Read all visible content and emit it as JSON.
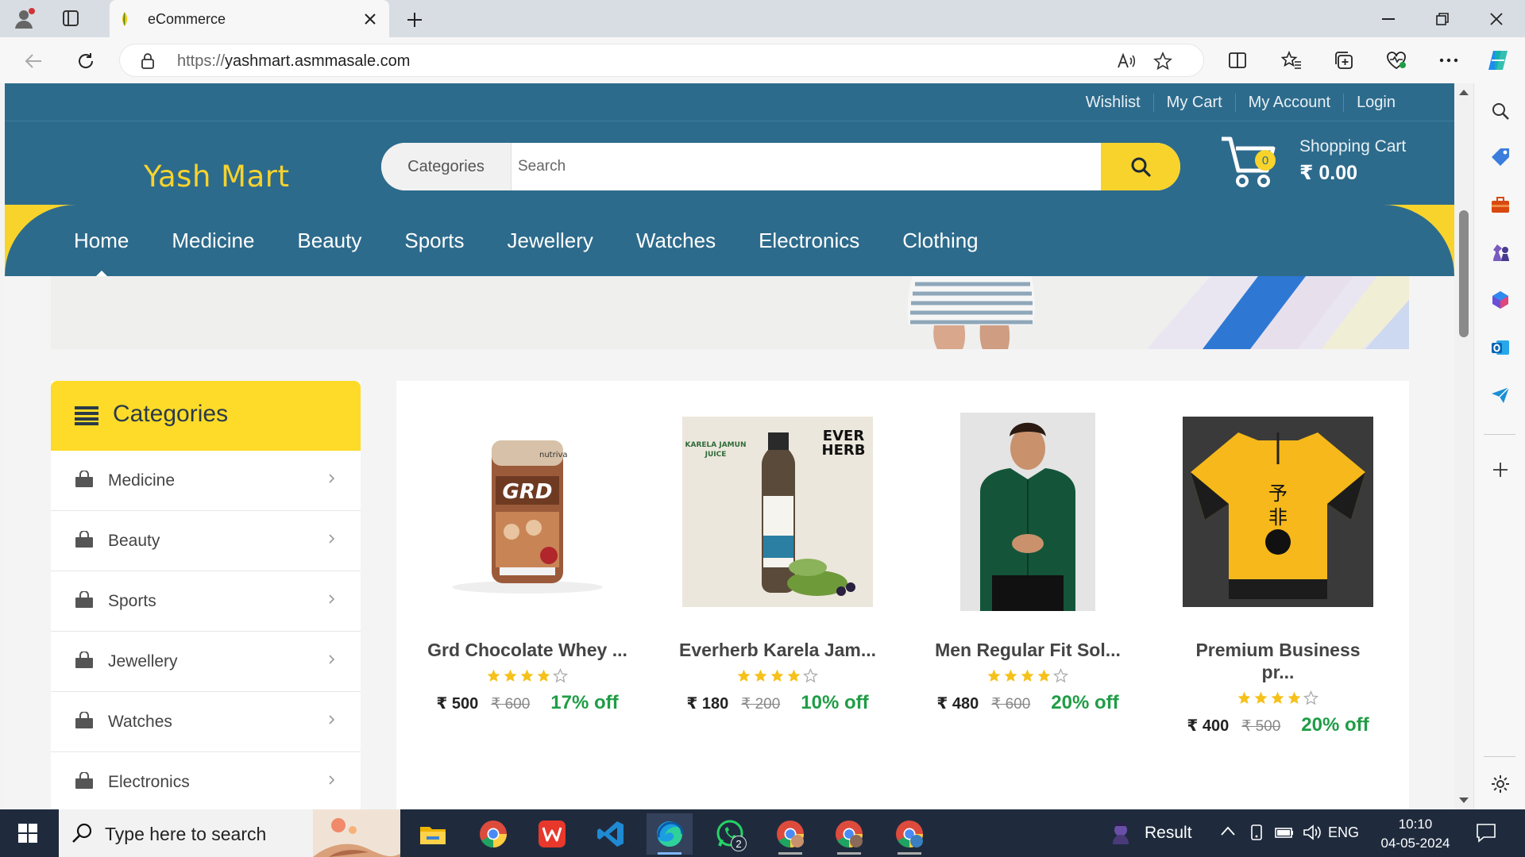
{
  "browser": {
    "tab_title": "eCommerce",
    "url_scheme": "https://",
    "url_host": "yashmart.asmmasale.com"
  },
  "site": {
    "top_links": [
      "Wishlist",
      "My Cart",
      "My Account",
      "Login"
    ],
    "logo": "Yash Mart",
    "search": {
      "category_label": "Categories",
      "placeholder": "Search"
    },
    "cart": {
      "count": "0",
      "label": "Shopping Cart",
      "total": "₹ 0.00"
    },
    "nav": [
      "Home",
      "Medicine",
      "Beauty",
      "Sports",
      "Jewellery",
      "Watches",
      "Electronics",
      "Clothing"
    ],
    "active_nav": "Home",
    "categories": {
      "title": "Categories",
      "items": [
        "Medicine",
        "Beauty",
        "Sports",
        "Jewellery",
        "Watches",
        "Electronics"
      ]
    },
    "products": [
      {
        "name": "Grd Chocolate Whey ...",
        "rating": 4,
        "price": "₹ 500",
        "mrp": "₹ 600",
        "discount": "17% off"
      },
      {
        "name": "Everherb Karela Jam...",
        "rating": 4,
        "price": "₹ 180",
        "mrp": "₹ 200",
        "discount": "10% off"
      },
      {
        "name": "Men Regular Fit Sol...",
        "rating": 4,
        "price": "₹ 480",
        "mrp": "₹ 600",
        "discount": "20% off"
      },
      {
        "name": "Premium Business pr...",
        "rating": 4,
        "price": "₹ 400",
        "mrp": "₹ 500",
        "discount": "20% off"
      }
    ]
  },
  "taskbar": {
    "search_placeholder": "Type here to search",
    "whatsapp_badge": "2",
    "widget_label": "Result",
    "language": "ENG",
    "time": "10:10",
    "date": "04-05-2024"
  },
  "colors": {
    "brand_blue": "#2d6b8c",
    "brand_yellow": "#f8d32c",
    "discount_green": "#1f9d46"
  }
}
